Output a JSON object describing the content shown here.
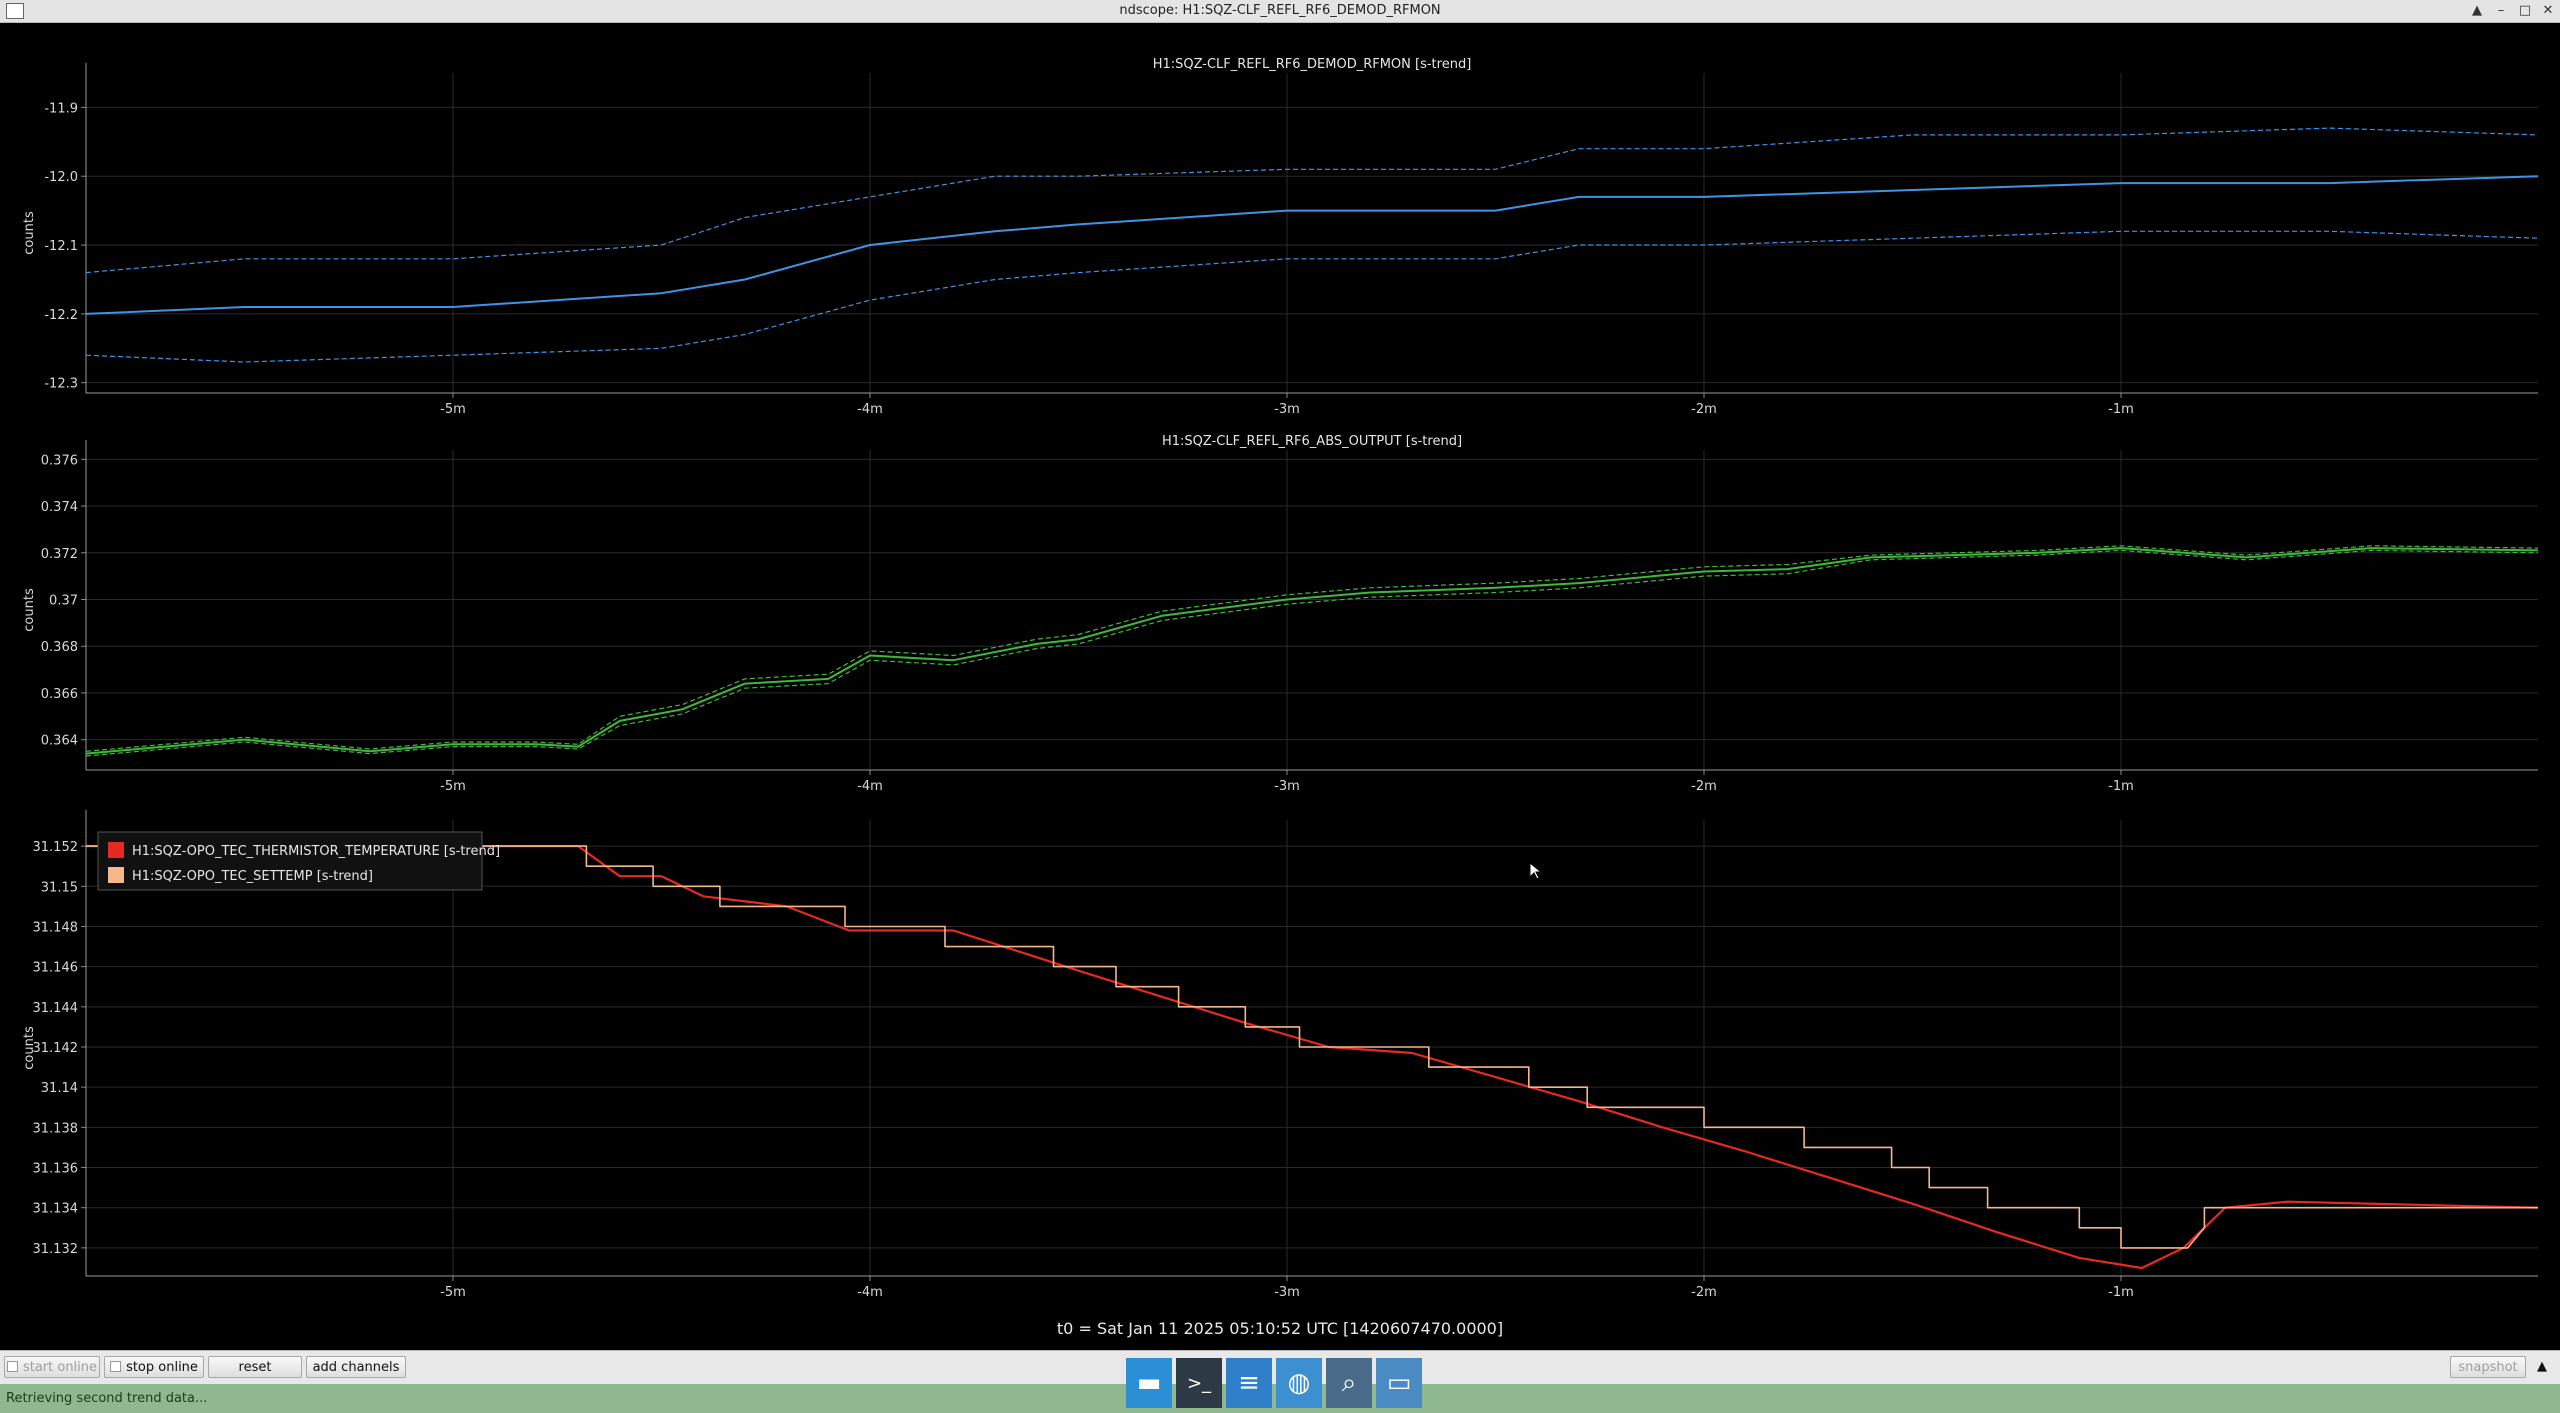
{
  "window": {
    "title": "ndscope: H1:SQZ-CLF_REFL_RF6_DEMOD_RFMON",
    "controls": [
      "▲",
      "–",
      "□",
      "✕"
    ]
  },
  "t0_label": "t0 = Sat Jan 11 2025 05:10:52 UTC [1420607470.0000]",
  "controls": {
    "start_online": "start online",
    "stop_online": "stop online",
    "reset": "reset",
    "add_channels": "add channels",
    "snapshot": "snapshot"
  },
  "status": {
    "message": "Retrieving second trend data..."
  },
  "taskbar": {
    "items": [
      {
        "name": "desktop-icon",
        "glyph": "▬"
      },
      {
        "name": "terminal-icon",
        "glyph": ">_"
      },
      {
        "name": "text-editor-icon",
        "glyph": "≡"
      },
      {
        "name": "web-browser-icon",
        "glyph": "◍"
      },
      {
        "name": "search-icon",
        "glyph": "⌕"
      },
      {
        "name": "file-manager-icon",
        "glyph": "▭"
      }
    ]
  },
  "colors": {
    "rfmon": "#3d94e6",
    "abs_output": "#3fb93a",
    "thermistor": "#e52a22",
    "settemp": "#f6b78a",
    "grid": "#2a2a2a"
  },
  "chart_data": [
    {
      "type": "line",
      "title": "H1:SQZ-CLF_REFL_RF6_DEMOD_RFMON [s-trend]",
      "xlabel": "",
      "ylabel": "counts",
      "xlim": [
        -5.88,
        0
      ],
      "ylim": [
        -12.315,
        -11.85
      ],
      "yticks": [
        -11.9,
        -12.0,
        -12.1,
        -12.2,
        -12.3
      ],
      "ytick_labels": [
        "-11.9",
        "-12.0",
        "-12.1",
        "-12.2",
        "-12.3"
      ],
      "xticks": [
        -5,
        -4,
        -3,
        -2,
        -1
      ],
      "xtick_labels": [
        "-5m",
        "-4m",
        "-3m",
        "-2m",
        "-1m"
      ],
      "grid": true,
      "series": [
        {
          "role": "mean",
          "style": "solid",
          "x": [
            -5.88,
            -5.5,
            -5.0,
            -4.5,
            -4.3,
            -4.0,
            -3.7,
            -3.5,
            -3.0,
            -2.5,
            -2.3,
            -2.0,
            -1.5,
            -1.0,
            -0.5,
            0.0
          ],
          "y": [
            -12.2,
            -12.19,
            -12.19,
            -12.17,
            -12.15,
            -12.1,
            -12.08,
            -12.07,
            -12.05,
            -12.05,
            -12.03,
            -12.03,
            -12.02,
            -12.01,
            -12.01,
            -12.0
          ]
        },
        {
          "role": "max",
          "style": "dashed",
          "x": [
            -5.88,
            -5.5,
            -5.0,
            -4.5,
            -4.3,
            -4.0,
            -3.7,
            -3.5,
            -3.0,
            -2.5,
            -2.3,
            -2.0,
            -1.5,
            -1.0,
            -0.5,
            0.0
          ],
          "y": [
            -12.14,
            -12.12,
            -12.12,
            -12.1,
            -12.06,
            -12.03,
            -12.0,
            -12.0,
            -11.99,
            -11.99,
            -11.96,
            -11.96,
            -11.94,
            -11.94,
            -11.93,
            -11.94
          ]
        },
        {
          "role": "min",
          "style": "dashed",
          "x": [
            -5.88,
            -5.5,
            -5.0,
            -4.5,
            -4.3,
            -4.0,
            -3.7,
            -3.5,
            -3.0,
            -2.5,
            -2.3,
            -2.0,
            -1.5,
            -1.0,
            -0.5,
            0.0
          ],
          "y": [
            -12.26,
            -12.27,
            -12.26,
            -12.25,
            -12.23,
            -12.18,
            -12.15,
            -12.14,
            -12.12,
            -12.12,
            -12.1,
            -12.1,
            -12.09,
            -12.08,
            -12.08,
            -12.09
          ]
        }
      ]
    },
    {
      "type": "line",
      "title": "H1:SQZ-CLF_REFL_RF6_ABS_OUTPUT [s-trend]",
      "xlabel": "",
      "ylabel": "counts",
      "xlim": [
        -5.88,
        0
      ],
      "ylim": [
        0.3627,
        0.3764
      ],
      "yticks": [
        0.364,
        0.366,
        0.368,
        0.37,
        0.372,
        0.374,
        0.376
      ],
      "ytick_labels": [
        "0.364",
        "0.366",
        "0.368",
        "0.37",
        "0.372",
        "0.374",
        "0.376"
      ],
      "xticks": [
        -5,
        -4,
        -3,
        -2,
        -1
      ],
      "xtick_labels": [
        "-5m",
        "-4m",
        "-3m",
        "-2m",
        "-1m"
      ],
      "grid": true,
      "series": [
        {
          "role": "mean",
          "style": "solid",
          "x": [
            -5.88,
            -5.5,
            -5.2,
            -5.0,
            -4.8,
            -4.7,
            -4.6,
            -4.45,
            -4.3,
            -4.1,
            -4.0,
            -3.8,
            -3.6,
            -3.5,
            -3.3,
            -3.0,
            -2.8,
            -2.5,
            -2.3,
            -2.0,
            -1.8,
            -1.6,
            -1.2,
            -1.0,
            -0.7,
            -0.4,
            0.0
          ],
          "y": [
            0.3634,
            0.364,
            0.3635,
            0.3638,
            0.3638,
            0.3637,
            0.3648,
            0.3653,
            0.3664,
            0.3666,
            0.3676,
            0.3674,
            0.3681,
            0.3683,
            0.3693,
            0.37,
            0.3703,
            0.3705,
            0.3707,
            0.3712,
            0.3713,
            0.3718,
            0.372,
            0.3722,
            0.3718,
            0.3722,
            0.3721
          ]
        },
        {
          "role": "max",
          "style": "dashed",
          "x": [
            -5.88,
            -5.5,
            -5.2,
            -5.0,
            -4.8,
            -4.7,
            -4.6,
            -4.45,
            -4.3,
            -4.1,
            -4.0,
            -3.8,
            -3.6,
            -3.5,
            -3.3,
            -3.0,
            -2.8,
            -2.5,
            -2.3,
            -2.0,
            -1.8,
            -1.6,
            -1.2,
            -1.0,
            -0.7,
            -0.4,
            0.0
          ],
          "y": [
            0.3635,
            0.3641,
            0.3636,
            0.3639,
            0.3639,
            0.3638,
            0.365,
            0.3655,
            0.3666,
            0.3668,
            0.3678,
            0.3676,
            0.3683,
            0.3685,
            0.3695,
            0.3702,
            0.3705,
            0.3707,
            0.3709,
            0.3714,
            0.3715,
            0.3719,
            0.3721,
            0.3723,
            0.3719,
            0.3723,
            0.3722
          ]
        },
        {
          "role": "min",
          "style": "dashed",
          "x": [
            -5.88,
            -5.5,
            -5.2,
            -5.0,
            -4.8,
            -4.7,
            -4.6,
            -4.45,
            -4.3,
            -4.1,
            -4.0,
            -3.8,
            -3.6,
            -3.5,
            -3.3,
            -3.0,
            -2.8,
            -2.5,
            -2.3,
            -2.0,
            -1.8,
            -1.6,
            -1.2,
            -1.0,
            -0.7,
            -0.4,
            0.0
          ],
          "y": [
            0.3633,
            0.3639,
            0.3634,
            0.3637,
            0.3637,
            0.3636,
            0.3646,
            0.3651,
            0.3662,
            0.3664,
            0.3674,
            0.3672,
            0.3679,
            0.3681,
            0.3691,
            0.3698,
            0.3701,
            0.3703,
            0.3705,
            0.371,
            0.3711,
            0.3717,
            0.3719,
            0.3721,
            0.3717,
            0.3721,
            0.372
          ]
        }
      ]
    },
    {
      "type": "line",
      "title": "",
      "xlabel": "",
      "ylabel": "counts",
      "xlim": [
        -5.88,
        0
      ],
      "ylim": [
        31.1306,
        31.1533
      ],
      "yticks": [
        31.132,
        31.134,
        31.136,
        31.138,
        31.14,
        31.142,
        31.144,
        31.146,
        31.148,
        31.15,
        31.152
      ],
      "ytick_labels": [
        "31.132",
        "31.134",
        "31.136",
        "31.138",
        "31.14",
        "31.142",
        "31.144",
        "31.146",
        "31.148",
        "31.15",
        "31.152"
      ],
      "xticks": [
        -5,
        -4,
        -3,
        -2,
        -1
      ],
      "xtick_labels": [
        "-5m",
        "-4m",
        "-3m",
        "-2m",
        "-1m"
      ],
      "grid": true,
      "legend": "top-left",
      "series": [
        {
          "name": "H1:SQZ-OPO_TEC_THERMISTOR_TEMPERATURE [s-trend]",
          "color_key": "thermistor",
          "x": [
            -5.88,
            -4.7,
            -4.6,
            -4.5,
            -4.4,
            -4.2,
            -4.05,
            -3.8,
            -3.65,
            -3.5,
            -3.3,
            -3.1,
            -2.9,
            -2.7,
            -2.5,
            -2.3,
            -2.1,
            -1.9,
            -1.7,
            -1.5,
            -1.3,
            -1.1,
            -0.95,
            -0.85,
            -0.75,
            -0.6,
            0.0
          ],
          "y": [
            31.152,
            31.152,
            31.1505,
            31.1505,
            31.1495,
            31.149,
            31.1478,
            31.1478,
            31.1468,
            31.1458,
            31.1445,
            31.1432,
            31.142,
            31.1417,
            31.1405,
            31.1393,
            31.138,
            31.1368,
            31.1355,
            31.1342,
            31.1328,
            31.1315,
            31.131,
            31.132,
            31.134,
            31.1343,
            31.134
          ]
        },
        {
          "name": "H1:SQZ-OPO_TEC_SETTEMP [s-trend]",
          "color_key": "settemp",
          "x": [
            -5.88,
            -4.68,
            -4.68,
            -4.52,
            -4.52,
            -4.36,
            -4.36,
            -4.06,
            -4.06,
            -3.82,
            -3.82,
            -3.56,
            -3.56,
            -3.41,
            -3.41,
            -3.26,
            -3.26,
            -3.1,
            -3.1,
            -2.97,
            -2.97,
            -2.66,
            -2.66,
            -2.42,
            -2.42,
            -2.28,
            -2.28,
            -2.0,
            -2.0,
            -1.76,
            -1.76,
            -1.55,
            -1.55,
            -1.46,
            -1.46,
            -1.32,
            -1.32,
            -1.1,
            -1.1,
            -1.0,
            -1.0,
            -0.84,
            -0.8,
            -0.8,
            0.0
          ],
          "y": [
            31.152,
            31.152,
            31.151,
            31.151,
            31.15,
            31.15,
            31.149,
            31.149,
            31.148,
            31.148,
            31.147,
            31.147,
            31.146,
            31.146,
            31.145,
            31.145,
            31.144,
            31.144,
            31.143,
            31.143,
            31.142,
            31.142,
            31.141,
            31.141,
            31.14,
            31.14,
            31.139,
            31.139,
            31.138,
            31.138,
            31.137,
            31.137,
            31.136,
            31.136,
            31.135,
            31.135,
            31.134,
            31.134,
            31.133,
            31.133,
            31.132,
            31.132,
            31.133,
            31.134,
            31.134
          ]
        }
      ]
    }
  ]
}
